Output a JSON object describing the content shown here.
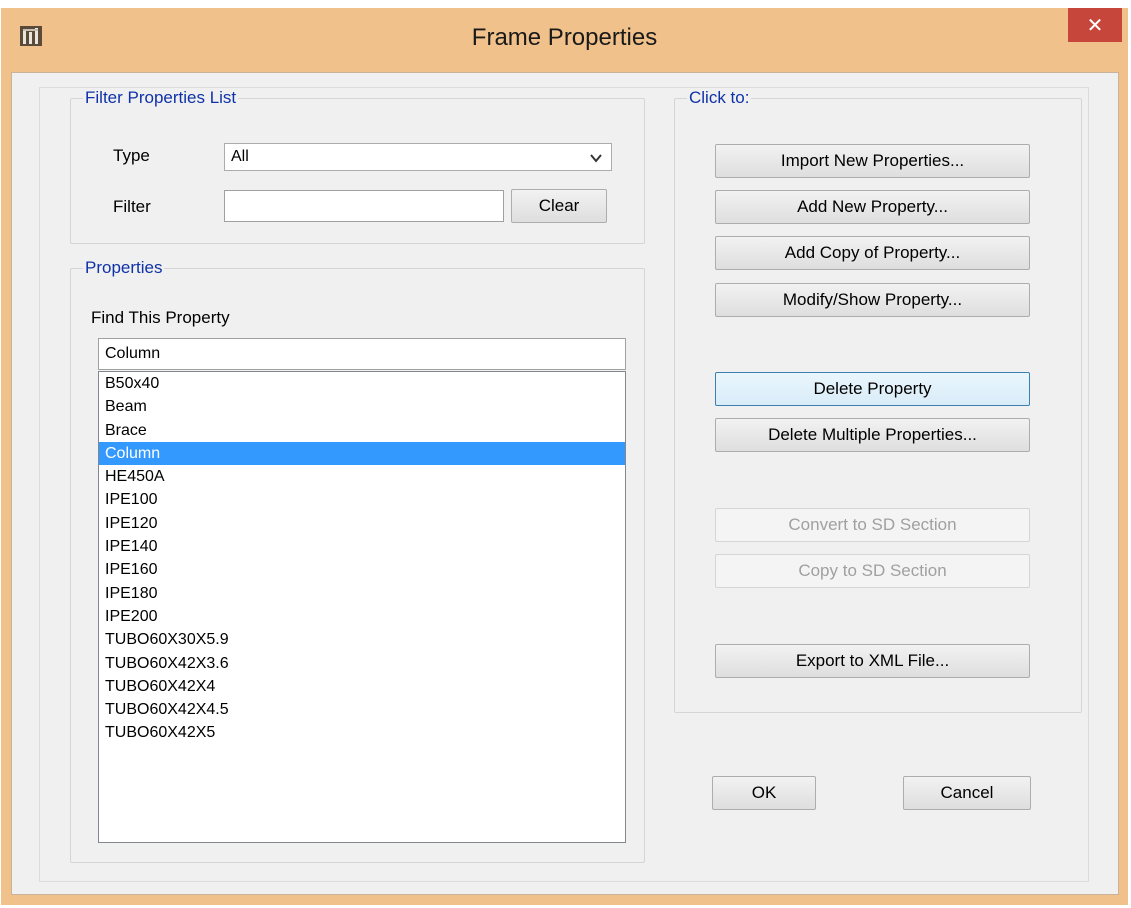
{
  "window": {
    "title": "Frame Properties",
    "close_label": "✕",
    "title_bar_color": "#f1c18b",
    "close_color": "#c7463b"
  },
  "filter_group": {
    "legend": "Filter Properties List",
    "type_label": "Type",
    "type_value": "All",
    "filter_label": "Filter",
    "filter_value": "",
    "clear_label": "Clear"
  },
  "properties_group": {
    "legend": "Properties",
    "find_label": "Find This Property",
    "find_value": "Column",
    "items": [
      {
        "label": "B50x40",
        "selected": false
      },
      {
        "label": "Beam",
        "selected": false
      },
      {
        "label": "Brace",
        "selected": false
      },
      {
        "label": "Column",
        "selected": true
      },
      {
        "label": "HE450A",
        "selected": false
      },
      {
        "label": "IPE100",
        "selected": false
      },
      {
        "label": "IPE120",
        "selected": false
      },
      {
        "label": "IPE140",
        "selected": false
      },
      {
        "label": "IPE160",
        "selected": false
      },
      {
        "label": "IPE180",
        "selected": false
      },
      {
        "label": "IPE200",
        "selected": false
      },
      {
        "label": "TUBO60X30X5.9",
        "selected": false
      },
      {
        "label": "TUBO60X42X3.6",
        "selected": false
      },
      {
        "label": "TUBO60X42X4",
        "selected": false
      },
      {
        "label": "TUBO60X42X4.5",
        "selected": false
      },
      {
        "label": "TUBO60X42X5",
        "selected": false
      }
    ],
    "selection_color": "#3399ff"
  },
  "actions_group": {
    "legend": "Click to:",
    "import_label": "Import New Properties...",
    "add_new_label": "Add New Property...",
    "add_copy_label": "Add Copy of Property...",
    "modify_label": "Modify/Show Property...",
    "delete_label": "Delete Property",
    "delete_multiple_label": "Delete Multiple Properties...",
    "convert_sd_label": "Convert to SD Section",
    "copy_sd_label": "Copy to SD Section",
    "export_xml_label": "Export to XML File..."
  },
  "footer": {
    "ok_label": "OK",
    "cancel_label": "Cancel"
  },
  "icons": {
    "app_icon": "etabs-app-icon",
    "close_icon": "close-icon",
    "dropdown_icon": "chevron-down-icon"
  }
}
